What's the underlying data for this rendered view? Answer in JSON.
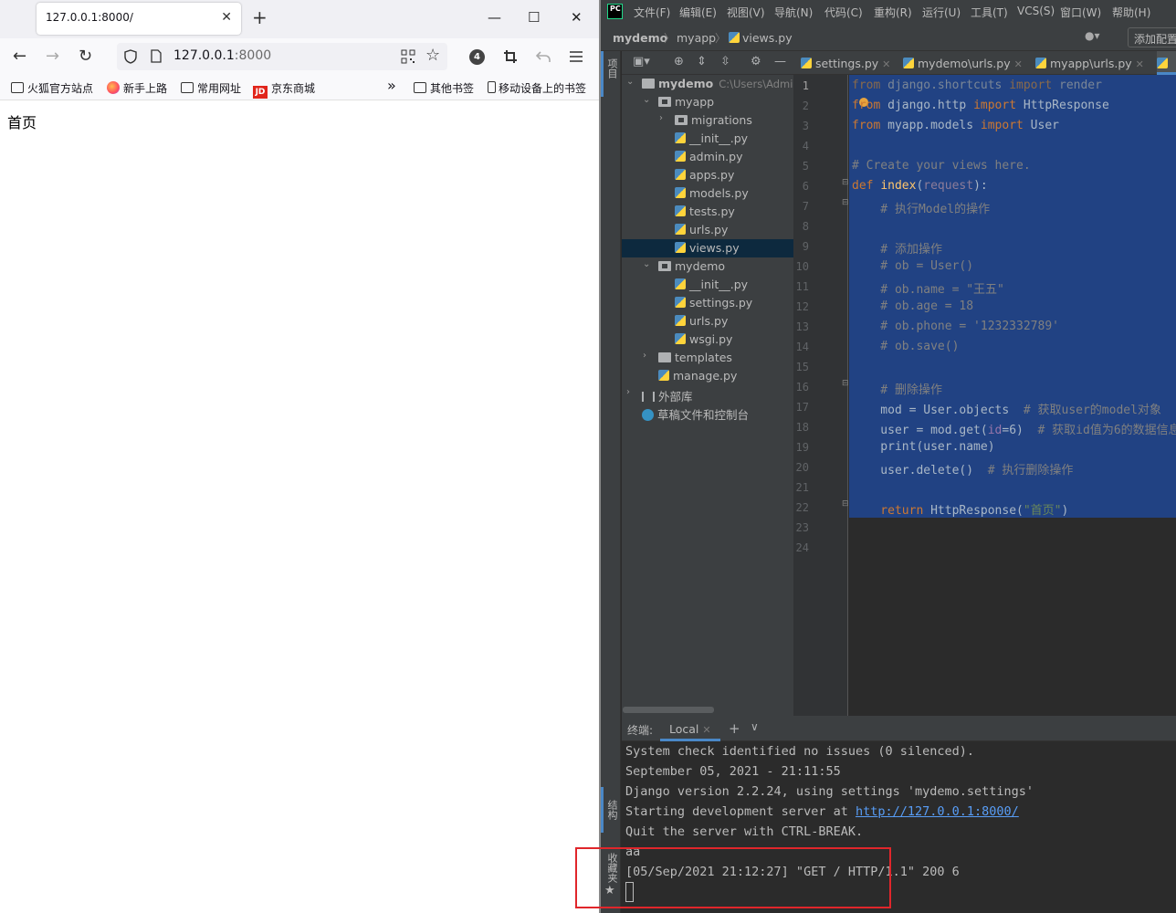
{
  "browser": {
    "tab_title": "127.0.0.1:8000/",
    "tab_close": "✕",
    "new_tab": "+",
    "window_controls": {
      "minimize": "—",
      "maximize": "☐",
      "close": "✕"
    },
    "nav": {
      "back": "←",
      "forward": "→",
      "reload": "↻"
    },
    "url_host": "127.0.0.1",
    "url_port": ":8000",
    "extension_badge": "4",
    "bookmarks": [
      "火狐官方站点",
      "新手上路",
      "常用网址",
      "京东商城"
    ],
    "bookmarks_overflow": "»",
    "bookmarks_right": [
      "其他书签",
      "移动设备上的书签"
    ],
    "jd_logo": "JD",
    "page_text": "首页"
  },
  "ide": {
    "logo": "PC",
    "menu": [
      "文件(F)",
      "编辑(E)",
      "视图(V)",
      "导航(N)",
      "代码(C)",
      "重构(R)",
      "运行(U)",
      "工具(T)",
      "VCS(S)",
      "窗口(W)",
      "帮助(H)"
    ],
    "breadcrumb": [
      "mydemo",
      "myapp",
      "views.py"
    ],
    "breadcrumb_sep": "〉",
    "add_config": "添加配置",
    "left_strip": {
      "project": "项目",
      "structure": "结构",
      "favorites": "收藏夹"
    },
    "editor_tabs": [
      "settings.py",
      "mydemo\\urls.py",
      "myapp\\urls.py"
    ],
    "tab_close": "✕",
    "tree": {
      "root_name": "mydemo",
      "root_path": "C:\\Users\\Admin",
      "items": [
        "myapp",
        "migrations",
        "__init__.py",
        "admin.py",
        "apps.py",
        "models.py",
        "tests.py",
        "urls.py",
        "views.py",
        "mydemo",
        "__init__.py",
        "settings.py",
        "urls.py",
        "wsgi.py",
        "templates",
        "manage.py",
        "外部库",
        "草稿文件和控制台"
      ]
    },
    "line_numbers": [
      "1",
      "2",
      "3",
      "4",
      "5",
      "6",
      "7",
      "8",
      "9",
      "10",
      "11",
      "12",
      "13",
      "14",
      "15",
      "16",
      "17",
      "18",
      "19",
      "20",
      "21",
      "22",
      "23",
      "24"
    ],
    "code": {
      "l1_kw": "from",
      "l1_mod": " django.shortcuts ",
      "l1_kw2": "import",
      "l1_name": " render",
      "l2_kw": "from",
      "l2_mod": " django.http ",
      "l2_kw2": "import",
      "l2_name": " HttpResponse",
      "l3_kw": "from",
      "l3_mod": " myapp.models ",
      "l3_kw2": "import",
      "l3_name": " User",
      "l5": "# Create your views here.",
      "l6_kw": "def",
      "l6_fn": "index",
      "l6_open": "(",
      "l6_param": "request",
      "l6_close": "):",
      "l7": "    # 执行Model的操作",
      "l9": "    # 添加操作",
      "l10": "    # ob = User()",
      "l11": "    # ob.name = \"王五\"",
      "l12": "    # ob.age = 18",
      "l13": "    # ob.phone = '1232332789'",
      "l14": "    # ob.save()",
      "l16": "    # 删除操作",
      "l17_code": "    mod = User.objects",
      "l17_cm": "  # 获取user的model对象",
      "l18_code": "    user = mod.get(",
      "l18_param": "id",
      "l18_eq": "=6)",
      "l18_cm": "  # 获取id值为6的数据信息",
      "l19": "    print(user.name)",
      "l20_code": "    user.delete()",
      "l20_cm": "  # 执行删除操作",
      "l22_kw": "    return",
      "l22_code": " HttpResponse(",
      "l22_str": "\"首页\"",
      "l22_close": ")"
    },
    "terminal": {
      "title": "终端:",
      "tab": "Local",
      "add": "+",
      "menu": "⌄",
      "lines": [
        "System check identified no issues (0 silenced).",
        "September 05, 2021 - 21:11:55",
        "Django version 2.2.24, using settings 'mydemo.settings'",
        "Starting development server at ",
        "Quit the server with CTRL-BREAK.",
        "aa",
        "[05/Sep/2021 21:12:27] \"GET / HTTP/1.1\" 200 6"
      ],
      "link": "http://127.0.0.1:8000/"
    }
  }
}
